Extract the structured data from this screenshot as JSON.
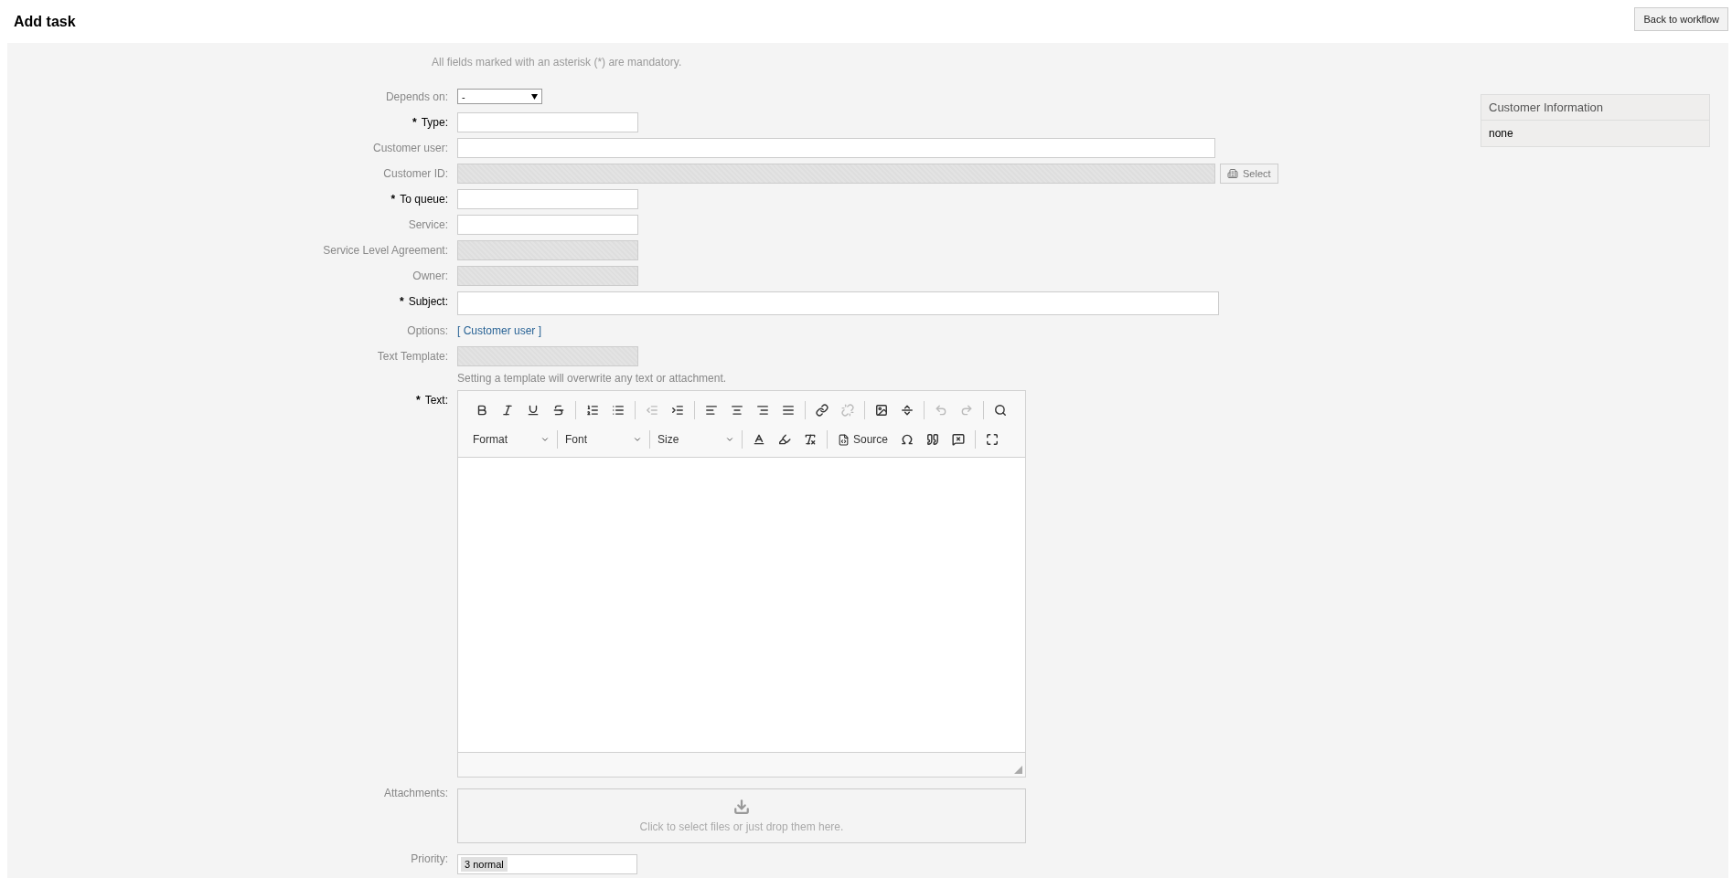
{
  "title": "Add task",
  "back_button": "Back to workflow",
  "mandatory_note": "All fields marked with an asterisk (*) are mandatory.",
  "required_mark": "*",
  "fields": [
    {
      "kind": "select",
      "label": "Depends on:",
      "required": false,
      "value": "-"
    },
    {
      "kind": "short_input",
      "label": "Type:",
      "required": true,
      "disabled": false
    },
    {
      "kind": "long_input",
      "label": "Customer user:",
      "required": false,
      "disabled": false
    },
    {
      "kind": "lookup",
      "label": "Customer ID:",
      "required": false,
      "disabled": true,
      "button": "Select"
    },
    {
      "kind": "short_input",
      "label": "To queue:",
      "required": true,
      "disabled": false
    },
    {
      "kind": "short_input",
      "label": "Service:",
      "required": false,
      "disabled": false
    },
    {
      "kind": "short_input",
      "label": "Service Level Agreement:",
      "required": false,
      "disabled": true
    },
    {
      "kind": "short_input",
      "label": "Owner:",
      "required": false,
      "disabled": true
    },
    {
      "kind": "wide_input",
      "label": "Subject:",
      "required": true,
      "disabled": false
    },
    {
      "kind": "options",
      "label": "Options:",
      "required": false,
      "link": "[ Customer user ]"
    },
    {
      "kind": "short_input",
      "label": "Text Template:",
      "required": false,
      "disabled": true,
      "hint": "Setting a template will overwrite any text or attachment."
    },
    {
      "kind": "editor",
      "label": "Text:",
      "required": true
    },
    {
      "kind": "attachments",
      "label": "Attachments:",
      "required": false,
      "prompt": "Click to select files or just drop them here."
    },
    {
      "kind": "priority",
      "label": "Priority:",
      "required": false,
      "value": "3 normal"
    }
  ],
  "editor_toolbar": {
    "row_1": [
      [
        {
          "disabled": false
        },
        {
          "disabled": false
        },
        {
          "disabled": false
        },
        {
          "disabled": false
        }
      ],
      [
        {
          "disabled": false
        },
        {
          "disabled": false
        }
      ],
      [
        {
          "disabled": true
        },
        {
          "disabled": false
        }
      ],
      [
        {
          "disabled": false
        },
        {
          "disabled": false
        },
        {
          "disabled": false
        },
        {
          "disabled": false
        }
      ],
      [
        {
          "disabled": false
        },
        {
          "disabled": true
        }
      ],
      [
        {
          "disabled": false
        },
        {
          "disabled": false
        }
      ],
      [
        {
          "disabled": true
        },
        {
          "disabled": true
        }
      ],
      [
        {
          "disabled": false
        }
      ]
    ],
    "row_2": [
      [
        {
          "kind": "dropdown",
          "label": "Format"
        }
      ],
      [
        {
          "kind": "dropdown",
          "label": "Font"
        }
      ],
      [
        {
          "kind": "dropdown",
          "label": "Size"
        }
      ],
      [
        {
          "kind": "icon"
        },
        {
          "kind": "icon"
        },
        {
          "kind": "icon"
        }
      ],
      [
        {
          "kind": "labeled",
          "label": "Source"
        },
        {
          "kind": "icon"
        },
        {
          "kind": "icon"
        },
        {
          "kind": "icon"
        }
      ],
      [
        {
          "kind": "icon"
        }
      ]
    ]
  },
  "customer_information": {
    "title": "Customer Information",
    "value": "none"
  }
}
